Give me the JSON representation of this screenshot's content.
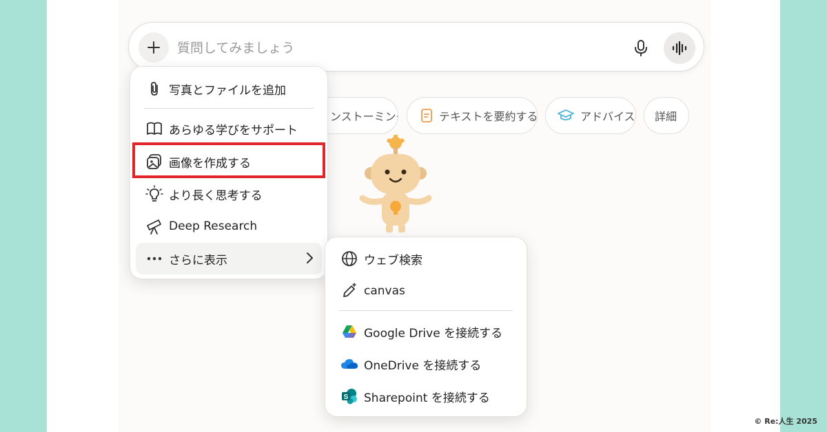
{
  "composer": {
    "placeholder": "質問してみましょう",
    "plus_icon": "plus-icon",
    "mic_icon": "mic-icon",
    "voice_icon": "voice-wave-icon"
  },
  "chips": [
    {
      "label": "ンストーミング",
      "icon": "none"
    },
    {
      "label": "テキストを要約する",
      "icon": "document-icon",
      "color": "#f0a35a"
    },
    {
      "label": "アドバイス",
      "icon": "graduation-cap-icon",
      "color": "#5ab8d9"
    },
    {
      "label": "詳細",
      "icon": "none"
    }
  ],
  "attach_menu": {
    "items": [
      {
        "label": "写真とファイルを追加",
        "icon": "paperclip-icon"
      },
      {
        "label": "あらゆる学びをサポート",
        "icon": "book-icon"
      },
      {
        "label": "画像を作成する",
        "icon": "image-create-icon",
        "highlighted": true
      },
      {
        "label": "より長く思考する",
        "icon": "lightbulb-icon"
      },
      {
        "label": "Deep Research",
        "icon": "telescope-icon"
      },
      {
        "label": "さらに表示",
        "icon": "more-dots-icon",
        "has_submenu": true
      }
    ]
  },
  "submenu": {
    "items": [
      {
        "label": "ウェブ検索",
        "icon": "globe-icon"
      },
      {
        "label": "canvas",
        "icon": "pencil-sparkle-icon"
      },
      {
        "label": "Google Drive を接続する",
        "icon": "google-drive-icon"
      },
      {
        "label": "OneDrive を接続する",
        "icon": "onedrive-icon"
      },
      {
        "label": "Sharepoint を接続する",
        "icon": "sharepoint-icon"
      }
    ]
  },
  "highlight_color": "#e1262b",
  "copyright": "© Re:人生 2025"
}
